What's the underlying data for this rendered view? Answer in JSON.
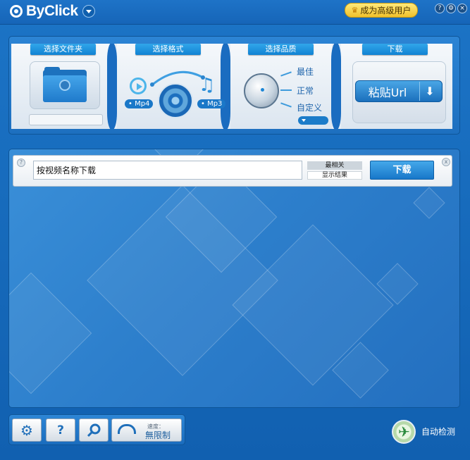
{
  "app": {
    "title": "ByClick",
    "premium_label": "成为高级用户",
    "window_buttons": [
      "?",
      "⚙",
      "×"
    ]
  },
  "steps": {
    "folder": {
      "label": "选择文件夹"
    },
    "format": {
      "label": "选择格式",
      "mp4": "Mp4",
      "mp3": "Mp3"
    },
    "quality": {
      "label": "选择品质",
      "options": [
        "最佳",
        "正常",
        "自定义"
      ]
    },
    "download": {
      "label": "下载",
      "paste_label": "粘贴Url"
    }
  },
  "search": {
    "value": "按视频名称下载",
    "sort_options": [
      "最相关",
      "显示结果"
    ],
    "download_button": "下载",
    "help": "?",
    "close": "x"
  },
  "footer": {
    "settings_icon": "gear-icon",
    "help_label": "?",
    "search_icon": "magnifier-icon",
    "speed_caption": "速度：",
    "speed_value": "無限制",
    "auto_detect": "自动检测"
  },
  "colors": {
    "accent": "#1a78c8",
    "premium": "#f5d24a"
  }
}
